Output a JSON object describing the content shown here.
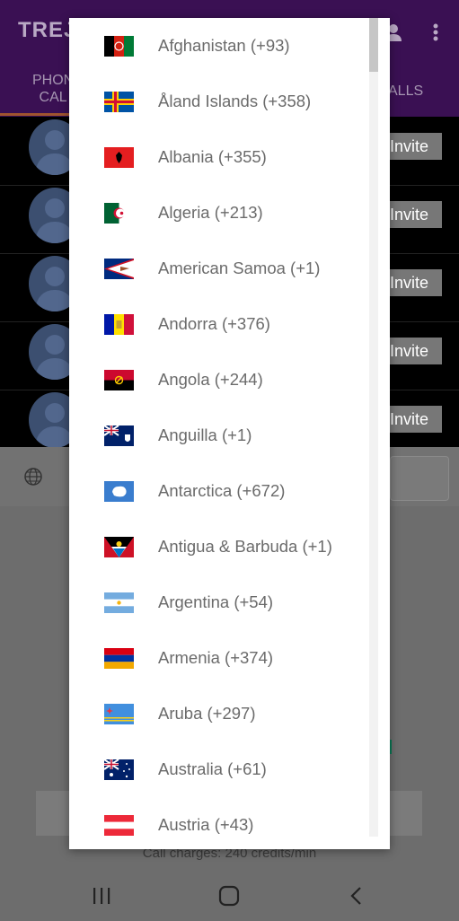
{
  "app": {
    "title": "TREJ",
    "tabs": [
      {
        "label_line1": "PHON",
        "label_line2": "CAL"
      },
      {
        "label_line1": "ALLS",
        "label_line2": ""
      }
    ],
    "contacts": [
      {
        "action": "Invite"
      },
      {
        "action": "Invite"
      },
      {
        "action": "Invite"
      },
      {
        "action": "Invite"
      },
      {
        "action": "Invite"
      }
    ],
    "call_charges": "Call charges: 240 credits/min"
  },
  "country_picker": {
    "items": [
      {
        "label": "Afghanistan (+93)",
        "flag": "afghanistan-flag"
      },
      {
        "label": "Åland Islands (+358)",
        "flag": "aland-flag"
      },
      {
        "label": "Albania (+355)",
        "flag": "albania-flag"
      },
      {
        "label": "Algeria (+213)",
        "flag": "algeria-flag"
      },
      {
        "label": "American Samoa (+1)",
        "flag": "american-samoa-flag"
      },
      {
        "label": "Andorra (+376)",
        "flag": "andorra-flag"
      },
      {
        "label": "Angola (+244)",
        "flag": "angola-flag"
      },
      {
        "label": "Anguilla (+1)",
        "flag": "anguilla-flag"
      },
      {
        "label": "Antarctica (+672)",
        "flag": "antarctica-flag"
      },
      {
        "label": "Antigua & Barbuda (+1)",
        "flag": "antigua-flag"
      },
      {
        "label": "Argentina (+54)",
        "flag": "argentina-flag"
      },
      {
        "label": "Armenia (+374)",
        "flag": "armenia-flag"
      },
      {
        "label": "Aruba (+297)",
        "flag": "aruba-flag"
      },
      {
        "label": "Australia (+61)",
        "flag": "australia-flag"
      },
      {
        "label": "Austria (+43)",
        "flag": "austria-flag"
      }
    ]
  },
  "colors": {
    "appbar": "#3a1053",
    "dialog_bg": "#ffffff",
    "text": "#6b6b6b"
  }
}
